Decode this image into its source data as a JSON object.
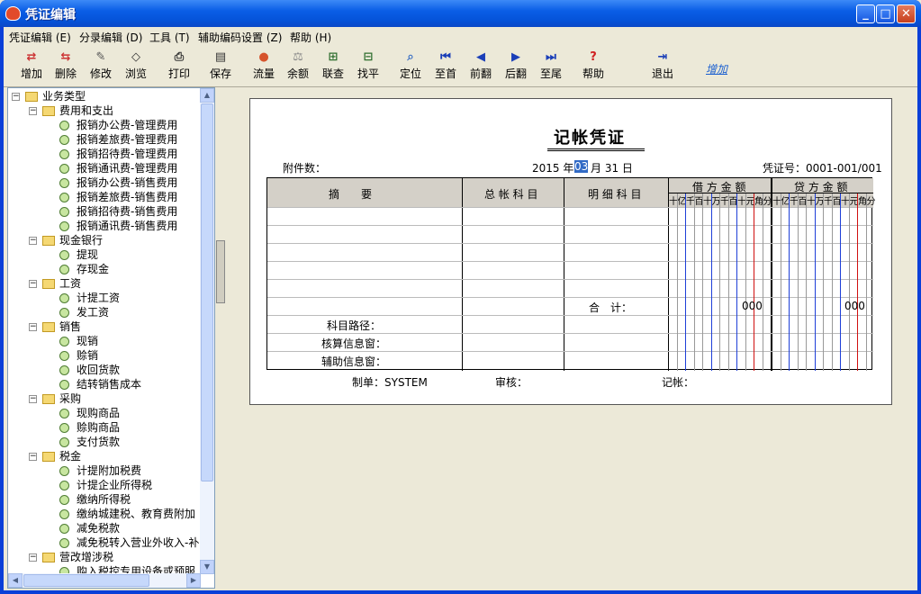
{
  "window": {
    "title": "凭证编辑"
  },
  "menu": [
    "凭证编辑 (E)",
    "分录编辑 (D)",
    "工具 (T)",
    "辅助编码设置 (Z)",
    "帮助 (H)"
  ],
  "toolbar": [
    {
      "label": "增加",
      "icon": "add-icon"
    },
    {
      "label": "删除",
      "icon": "delete-icon"
    },
    {
      "label": "修改",
      "icon": "edit-icon"
    },
    {
      "label": "浏览",
      "icon": "browse-icon"
    },
    {
      "label": "打印",
      "icon": "print-icon"
    },
    {
      "label": "保存",
      "icon": "save-icon"
    },
    {
      "label": "流量",
      "icon": "flow-icon"
    },
    {
      "label": "余额",
      "icon": "balance-icon"
    },
    {
      "label": "联查",
      "icon": "query-icon"
    },
    {
      "label": "找平",
      "icon": "balance-find-icon"
    },
    {
      "label": "定位",
      "icon": "locate-icon"
    },
    {
      "label": "至首",
      "icon": "first-icon"
    },
    {
      "label": "前翻",
      "icon": "prev-icon"
    },
    {
      "label": "后翻",
      "icon": "next-icon"
    },
    {
      "label": "至尾",
      "icon": "last-icon"
    },
    {
      "label": "帮助",
      "icon": "help-icon"
    },
    {
      "label": "退出",
      "icon": "exit-icon"
    }
  ],
  "add_link": "增加",
  "tree": {
    "root": "业务类型",
    "groups": [
      {
        "name": "费用和支出",
        "items": [
          "报销办公费-管理费用",
          "报销差旅费-管理费用",
          "报销招待费-管理费用",
          "报销通讯费-管理费用",
          "报销办公费-销售费用",
          "报销差旅费-销售费用",
          "报销招待费-销售费用",
          "报销通讯费-销售费用"
        ]
      },
      {
        "name": "现金银行",
        "items": [
          "提现",
          "存现金"
        ]
      },
      {
        "name": "工资",
        "items": [
          "计提工资",
          "发工资"
        ]
      },
      {
        "name": "销售",
        "items": [
          "现销",
          "赊销",
          "收回货款",
          "结转销售成本"
        ]
      },
      {
        "name": "采购",
        "items": [
          "现购商品",
          "赊购商品",
          "支付货款"
        ]
      },
      {
        "name": "税金",
        "items": [
          "计提附加税费",
          "计提企业所得税",
          "缴纳所得税",
          "缴纳城建税、教育费附加",
          "减免税款",
          "减免税转入营业外收入-补"
        ]
      },
      {
        "name": "营改增涉税",
        "items": [
          "购入税控专用设备或预服"
        ]
      }
    ]
  },
  "voucher": {
    "title": "记帐凭证",
    "attachments_label": "附件数：",
    "date_year": "2015 年",
    "date_month": "03",
    "date_rest": "月 31 日",
    "voucher_no": "凭证号：0001-001/001",
    "headers": {
      "summary": "摘　　要",
      "account": "总 帐 科 目",
      "detail": "明 细 科 目",
      "debit": "借 方 金 额",
      "credit": "贷 方 金 额"
    },
    "digit_units": "十亿千百十万千百十元角分",
    "total_label": "合　计：",
    "debit_total": "000",
    "credit_total": "000",
    "path_label": "科目路径：",
    "accounting_label": "核算信息窗：",
    "aux_label": "辅助信息窗：",
    "maker": "制单：SYSTEM",
    "reviewer": "审核：",
    "bookkeeper": "记帐："
  }
}
